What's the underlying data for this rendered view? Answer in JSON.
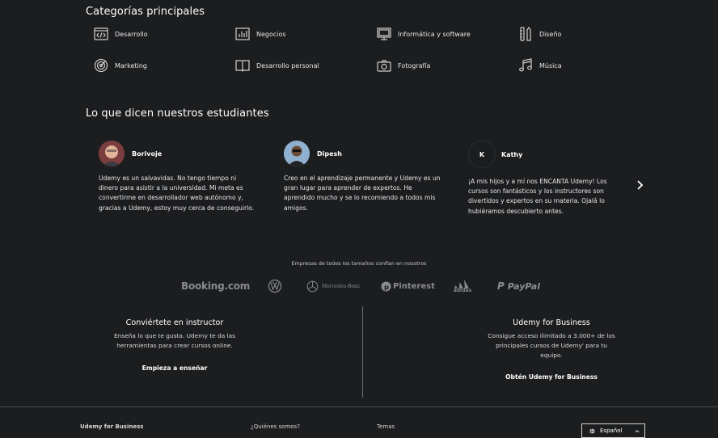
{
  "categories": {
    "title": "Categorías principales",
    "items": [
      {
        "label": "Desarrollo",
        "icon": "code-window-icon"
      },
      {
        "label": "Negocios",
        "icon": "bar-chart-icon"
      },
      {
        "label": "Informática y software",
        "icon": "monitor-icon"
      },
      {
        "label": "Diseño",
        "icon": "design-tools-icon"
      },
      {
        "label": "Marketing",
        "icon": "target-icon"
      },
      {
        "label": "Desarrollo personal",
        "icon": "book-icon"
      },
      {
        "label": "Fotografía",
        "icon": "camera-icon"
      },
      {
        "label": "Música",
        "icon": "music-note-icon"
      }
    ]
  },
  "testimonials": {
    "title": "Lo que dicen nuestros estudiantes",
    "items": [
      {
        "name": "Borivoje",
        "text": "Udemy es un salvavidas. No tengo tiempo ni dinero para asistir a la universidad. Mi meta es convertirme en desarrollador web autónomo y, gracias a Udemy, estoy muy cerca de conseguirlo."
      },
      {
        "name": "Dipesh",
        "text": "Creo en el aprendizaje permanente y Udemy es un gran lugar para aprender de expertos. He aprendido mucho y se lo recomiendo a todos mis amigos."
      },
      {
        "name": "Kathy",
        "initial": "K",
        "text": "¡A mis hijos y a mí nos ENCANTA Udemy! Los cursos son fantásticos y los instructores son divertidos y expertos en su materia. Ojalá lo hubiéramos descubierto antes."
      }
    ],
    "next_icon": "chevron-right-icon"
  },
  "trusted": {
    "caption": "Empresas de todos los tamaños confían en nosotros",
    "logos": [
      "Booking.com",
      "Volkswagen",
      "Mercedes-Benz",
      "Pinterest",
      "adidas",
      "PayPal"
    ]
  },
  "instructor": {
    "title": "Conviértete en instructor",
    "text": "Enseña lo que te gusta. Udemy te da las herramientas para crear cursos online.",
    "link": "Empieza a enseñar"
  },
  "business": {
    "title": "Udemy for Business",
    "text": "Consigue acceso ilimitado a 3.000+ de los principales cursos de Udemy' para tu equipo.",
    "link": "Obtén Udemy for Business"
  },
  "footer": {
    "link1": "Udemy for Business",
    "link2": "¿Quiénes somos?",
    "link3": "Temas",
    "language": "Español",
    "globe_icon": "globe-icon",
    "caret_icon": "chevron-up-icon"
  },
  "colors": {
    "background": "#1c1d1f",
    "divider": "#4a4b4e",
    "logo_gray": "#8a8b8e"
  }
}
